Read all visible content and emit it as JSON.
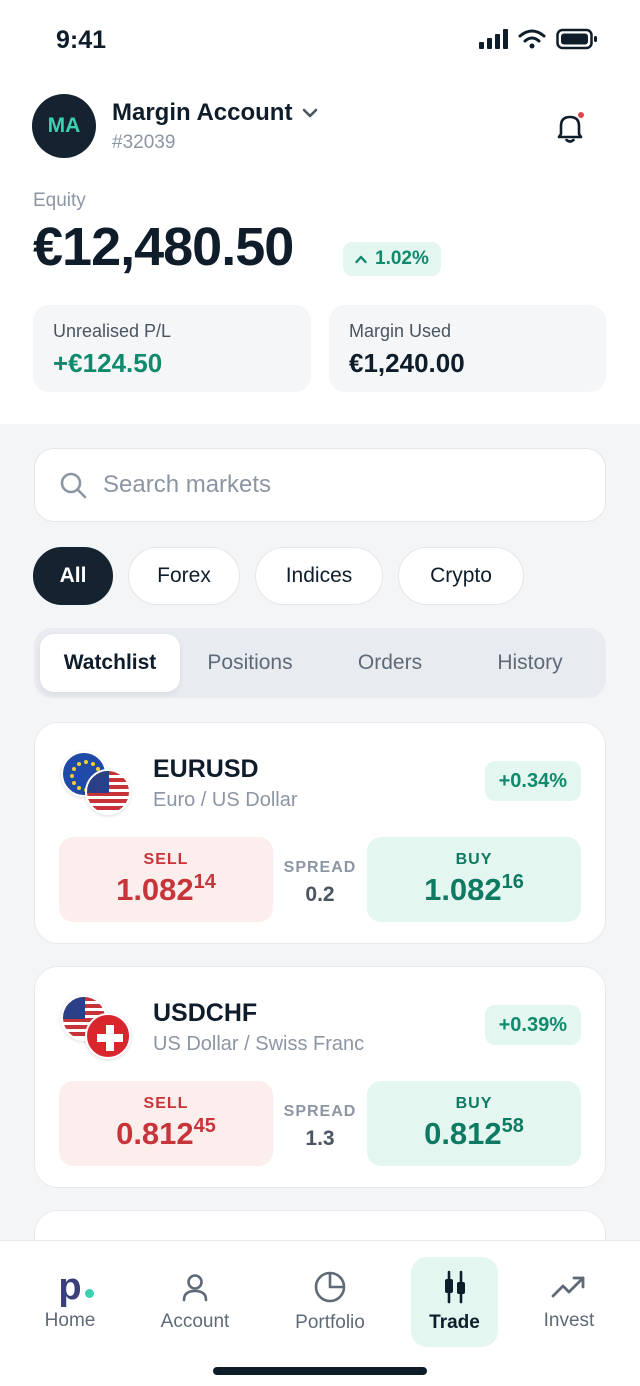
{
  "status_bar": {
    "time": "9:41"
  },
  "account": {
    "initials": "MA",
    "name": "Margin Account",
    "number": "#32039"
  },
  "equity": {
    "label": "Equity",
    "value": "€12,480.50",
    "change": "1.02%"
  },
  "stats": {
    "unrealised_label": "Unrealised P/L",
    "unrealised_value": "+€124.50",
    "margin_label": "Margin Used",
    "margin_value": "€1,240.00"
  },
  "search": {
    "placeholder": "Search markets"
  },
  "filters": [
    "All",
    "Forex",
    "Indices",
    "Crypto"
  ],
  "tabs": [
    "Watchlist",
    "Positions",
    "Orders",
    "History"
  ],
  "quote_labels": {
    "sell": "SELL",
    "buy": "BUY",
    "spread": "SPREAD"
  },
  "markets": [
    {
      "symbol": "EURUSD",
      "name": "Euro / US Dollar",
      "change": "+0.34%",
      "sell_main": "1.082",
      "sell_pip": "14",
      "buy_main": "1.082",
      "buy_pip": "16",
      "spread": "0.2"
    },
    {
      "symbol": "USDCHF",
      "name": "US Dollar / Swiss Franc",
      "change": "+0.39%",
      "sell_main": "0.812",
      "sell_pip": "45",
      "buy_main": "0.812",
      "buy_pip": "58",
      "spread": "1.3"
    }
  ],
  "nav": {
    "home": "Home",
    "account": "Account",
    "portfolio": "Portfolio",
    "trade": "Trade",
    "invest": "Invest",
    "home_logo": "p"
  },
  "colors": {
    "brand_dark": "#14232f",
    "positive": "#0f8a6d",
    "negative": "#c7343a",
    "accent_teal": "#3ad1b0"
  }
}
